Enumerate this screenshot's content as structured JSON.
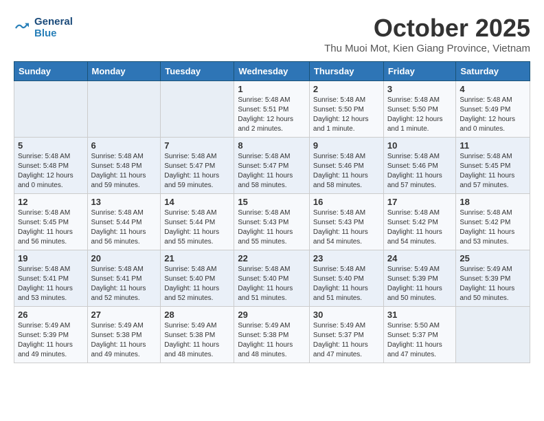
{
  "header": {
    "logo_line1": "General",
    "logo_line2": "Blue",
    "month": "October 2025",
    "location": "Thu Muoi Mot, Kien Giang Province, Vietnam"
  },
  "weekdays": [
    "Sunday",
    "Monday",
    "Tuesday",
    "Wednesday",
    "Thursday",
    "Friday",
    "Saturday"
  ],
  "weeks": [
    [
      {
        "day": "",
        "info": ""
      },
      {
        "day": "",
        "info": ""
      },
      {
        "day": "",
        "info": ""
      },
      {
        "day": "1",
        "info": "Sunrise: 5:48 AM\nSunset: 5:51 PM\nDaylight: 12 hours\nand 2 minutes."
      },
      {
        "day": "2",
        "info": "Sunrise: 5:48 AM\nSunset: 5:50 PM\nDaylight: 12 hours\nand 1 minute."
      },
      {
        "day": "3",
        "info": "Sunrise: 5:48 AM\nSunset: 5:50 PM\nDaylight: 12 hours\nand 1 minute."
      },
      {
        "day": "4",
        "info": "Sunrise: 5:48 AM\nSunset: 5:49 PM\nDaylight: 12 hours\nand 0 minutes."
      }
    ],
    [
      {
        "day": "5",
        "info": "Sunrise: 5:48 AM\nSunset: 5:48 PM\nDaylight: 12 hours\nand 0 minutes."
      },
      {
        "day": "6",
        "info": "Sunrise: 5:48 AM\nSunset: 5:48 PM\nDaylight: 11 hours\nand 59 minutes."
      },
      {
        "day": "7",
        "info": "Sunrise: 5:48 AM\nSunset: 5:47 PM\nDaylight: 11 hours\nand 59 minutes."
      },
      {
        "day": "8",
        "info": "Sunrise: 5:48 AM\nSunset: 5:47 PM\nDaylight: 11 hours\nand 58 minutes."
      },
      {
        "day": "9",
        "info": "Sunrise: 5:48 AM\nSunset: 5:46 PM\nDaylight: 11 hours\nand 58 minutes."
      },
      {
        "day": "10",
        "info": "Sunrise: 5:48 AM\nSunset: 5:46 PM\nDaylight: 11 hours\nand 57 minutes."
      },
      {
        "day": "11",
        "info": "Sunrise: 5:48 AM\nSunset: 5:45 PM\nDaylight: 11 hours\nand 57 minutes."
      }
    ],
    [
      {
        "day": "12",
        "info": "Sunrise: 5:48 AM\nSunset: 5:45 PM\nDaylight: 11 hours\nand 56 minutes."
      },
      {
        "day": "13",
        "info": "Sunrise: 5:48 AM\nSunset: 5:44 PM\nDaylight: 11 hours\nand 56 minutes."
      },
      {
        "day": "14",
        "info": "Sunrise: 5:48 AM\nSunset: 5:44 PM\nDaylight: 11 hours\nand 55 minutes."
      },
      {
        "day": "15",
        "info": "Sunrise: 5:48 AM\nSunset: 5:43 PM\nDaylight: 11 hours\nand 55 minutes."
      },
      {
        "day": "16",
        "info": "Sunrise: 5:48 AM\nSunset: 5:43 PM\nDaylight: 11 hours\nand 54 minutes."
      },
      {
        "day": "17",
        "info": "Sunrise: 5:48 AM\nSunset: 5:42 PM\nDaylight: 11 hours\nand 54 minutes."
      },
      {
        "day": "18",
        "info": "Sunrise: 5:48 AM\nSunset: 5:42 PM\nDaylight: 11 hours\nand 53 minutes."
      }
    ],
    [
      {
        "day": "19",
        "info": "Sunrise: 5:48 AM\nSunset: 5:41 PM\nDaylight: 11 hours\nand 53 minutes."
      },
      {
        "day": "20",
        "info": "Sunrise: 5:48 AM\nSunset: 5:41 PM\nDaylight: 11 hours\nand 52 minutes."
      },
      {
        "day": "21",
        "info": "Sunrise: 5:48 AM\nSunset: 5:40 PM\nDaylight: 11 hours\nand 52 minutes."
      },
      {
        "day": "22",
        "info": "Sunrise: 5:48 AM\nSunset: 5:40 PM\nDaylight: 11 hours\nand 51 minutes."
      },
      {
        "day": "23",
        "info": "Sunrise: 5:48 AM\nSunset: 5:40 PM\nDaylight: 11 hours\nand 51 minutes."
      },
      {
        "day": "24",
        "info": "Sunrise: 5:49 AM\nSunset: 5:39 PM\nDaylight: 11 hours\nand 50 minutes."
      },
      {
        "day": "25",
        "info": "Sunrise: 5:49 AM\nSunset: 5:39 PM\nDaylight: 11 hours\nand 50 minutes."
      }
    ],
    [
      {
        "day": "26",
        "info": "Sunrise: 5:49 AM\nSunset: 5:39 PM\nDaylight: 11 hours\nand 49 minutes."
      },
      {
        "day": "27",
        "info": "Sunrise: 5:49 AM\nSunset: 5:38 PM\nDaylight: 11 hours\nand 49 minutes."
      },
      {
        "day": "28",
        "info": "Sunrise: 5:49 AM\nSunset: 5:38 PM\nDaylight: 11 hours\nand 48 minutes."
      },
      {
        "day": "29",
        "info": "Sunrise: 5:49 AM\nSunset: 5:38 PM\nDaylight: 11 hours\nand 48 minutes."
      },
      {
        "day": "30",
        "info": "Sunrise: 5:49 AM\nSunset: 5:37 PM\nDaylight: 11 hours\nand 47 minutes."
      },
      {
        "day": "31",
        "info": "Sunrise: 5:50 AM\nSunset: 5:37 PM\nDaylight: 11 hours\nand 47 minutes."
      },
      {
        "day": "",
        "info": ""
      }
    ]
  ]
}
